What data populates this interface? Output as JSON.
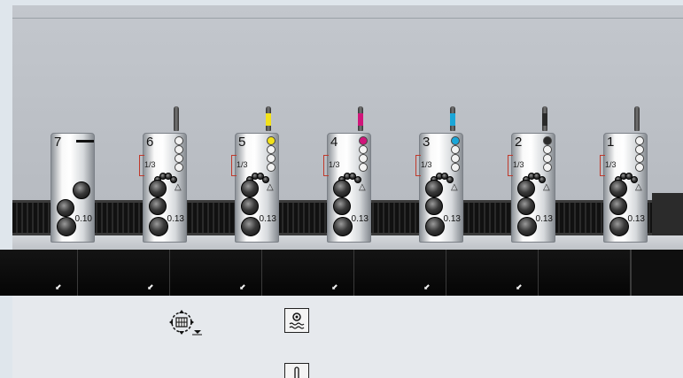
{
  "units": [
    {
      "number": "7",
      "ratio": "",
      "value": "0.10",
      "ink_color": "",
      "ink_name": "none"
    },
    {
      "number": "6",
      "ratio": "1/3",
      "value": "0.13",
      "ink_color": "#555555",
      "ink_name": "grey"
    },
    {
      "number": "5",
      "ratio": "1/3",
      "value": "0.13",
      "ink_color": "#f2e11a",
      "ink_name": "yellow"
    },
    {
      "number": "4",
      "ratio": "1/3",
      "value": "0.13",
      "ink_color": "#d0157a",
      "ink_name": "magenta"
    },
    {
      "number": "3",
      "ratio": "1/3",
      "value": "0.13",
      "ink_color": "#1ba6d8",
      "ink_name": "cyan"
    },
    {
      "number": "2",
      "ratio": "1/3",
      "value": "0.13",
      "ink_color": "#2a2a2a",
      "ink_name": "black"
    },
    {
      "number": "1",
      "ratio": "1/3",
      "value": "0.13",
      "ink_color": "#555555",
      "ink_name": "grey"
    }
  ],
  "unit7_symbol": "▬▬",
  "trays": [
    {
      "arrow": true
    },
    {
      "arrow": true
    },
    {
      "arrow": true
    },
    {
      "arrow": true
    },
    {
      "arrow": true
    },
    {
      "arrow": true
    },
    {
      "arrow": false
    }
  ],
  "tools": [
    {
      "name": "cylinder-positioning",
      "icon": "rotation-target-icon"
    },
    {
      "name": "washing-program",
      "icon": "wash-gear-icon"
    },
    {
      "name": "temperature",
      "icon": "thermometer-icon"
    }
  ],
  "colors": {
    "background": "#e3e7ec",
    "sky": "#bcc0c6",
    "belt": "#111111"
  }
}
